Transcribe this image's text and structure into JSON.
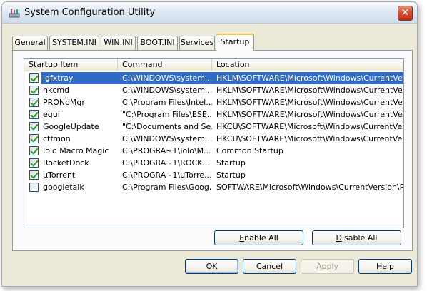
{
  "window": {
    "title": "System Configuration Utility"
  },
  "tabs": [
    {
      "label": "General",
      "active": false
    },
    {
      "label": "SYSTEM.INI",
      "active": false
    },
    {
      "label": "WIN.INI",
      "active": false
    },
    {
      "label": "BOOT.INI",
      "active": false
    },
    {
      "label": "Services",
      "active": false
    },
    {
      "label": "Startup",
      "active": true
    }
  ],
  "listview": {
    "columns": [
      "Startup Item",
      "Command",
      "Location"
    ],
    "rows": [
      {
        "item": "igfxtray",
        "command": "C:\\WINDOWS\\system...",
        "location": "HKLM\\SOFTWARE\\Microsoft\\Windows\\CurrentVer...",
        "checked": true,
        "selected": true
      },
      {
        "item": "hkcmd",
        "command": "C:\\WINDOWS\\system...",
        "location": "HKLM\\SOFTWARE\\Microsoft\\Windows\\CurrentVer...",
        "checked": true,
        "selected": false
      },
      {
        "item": "PRONoMgr",
        "command": "C:\\Program Files\\Intel...",
        "location": "HKLM\\SOFTWARE\\Microsoft\\Windows\\CurrentVer...",
        "checked": true,
        "selected": false
      },
      {
        "item": "egui",
        "command": "\"C:\\Program Files\\ESE...",
        "location": "HKLM\\SOFTWARE\\Microsoft\\Windows\\CurrentVer...",
        "checked": true,
        "selected": false
      },
      {
        "item": "GoogleUpdate",
        "command": "\"C:\\Documents and Se...",
        "location": "HKCU\\SOFTWARE\\Microsoft\\Windows\\CurrentVer...",
        "checked": true,
        "selected": false
      },
      {
        "item": "ctfmon",
        "command": "C:\\WINDOWS\\system...",
        "location": "HKCU\\SOFTWARE\\Microsoft\\Windows\\CurrentVer...",
        "checked": true,
        "selected": false
      },
      {
        "item": "Iolo Macro Magic",
        "command": "C:\\PROGRA~1\\Iolo\\M...",
        "location": "Common Startup",
        "checked": true,
        "selected": false
      },
      {
        "item": "RocketDock",
        "command": "C:\\PROGRA~1\\ROCK...",
        "location": "Startup",
        "checked": true,
        "selected": false
      },
      {
        "item": "µTorrent",
        "command": "C:\\PROGRA~1\\uTorre...",
        "location": "Startup",
        "checked": true,
        "selected": false
      },
      {
        "item": "googletalk",
        "command": "C:\\Program Files\\Goog...",
        "location": "SOFTWARE\\Microsoft\\Windows\\CurrentVersion\\Run",
        "checked": false,
        "selected": false
      }
    ]
  },
  "buttons": {
    "enable_all_pre": "",
    "enable_all_ul": "E",
    "enable_all_post": "nable All",
    "disable_all_pre": "",
    "disable_all_ul": "D",
    "disable_all_post": "isable All",
    "ok": "OK",
    "cancel": "Cancel",
    "apply_pre": "",
    "apply_ul": "A",
    "apply_post": "pply",
    "help": "Help"
  },
  "colors": {
    "selection": "#316ac5",
    "close_button": "#d5472a",
    "tab_highlight": "#ffc83c"
  }
}
